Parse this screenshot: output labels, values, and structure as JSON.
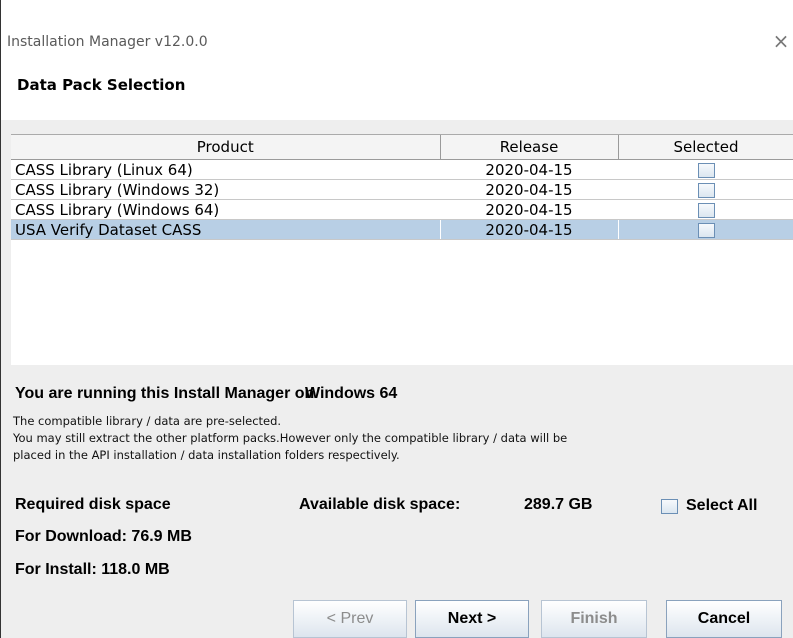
{
  "window": {
    "title": "Installation Manager v12.0.0",
    "close_glyph": "×"
  },
  "header": {
    "subtitle": "Data Pack Selection"
  },
  "table": {
    "columns": [
      "Product",
      "Release",
      "Selected"
    ],
    "rows": [
      {
        "product": "CASS Library (Linux 64)",
        "release": "2020-04-15",
        "selected": false
      },
      {
        "product": "CASS Library (Windows 32)",
        "release": "2020-04-15",
        "selected": false
      },
      {
        "product": "CASS Library (Windows 64)",
        "release": "2020-04-15",
        "selected": false
      },
      {
        "product": "USA Verify Dataset CASS",
        "release": "2020-04-15",
        "selected": false
      }
    ],
    "highlighted_row": 3,
    "highlight_color": "#b8cfe5"
  },
  "info": {
    "running_label": "You are running this Install Manager on",
    "os": "Windows 64",
    "line1": "The compatible library / data are pre-selected.",
    "line2": "You may still extract the other platform packs.However only the compatible library / data will be",
    "line3": "placed in the API installation / data installation folders respectively."
  },
  "disk": {
    "required_label": "Required disk space",
    "available_label": "Available disk space:",
    "available_value": "289.7 GB",
    "download_label": "For Download: 76.9 MB",
    "install_label": "For Install: 118.0 MB",
    "select_all_label": "Select All",
    "select_all_checked": false
  },
  "buttons": {
    "prev": "< Prev",
    "next": "Next >",
    "finish": "Finish",
    "cancel": "Cancel"
  }
}
